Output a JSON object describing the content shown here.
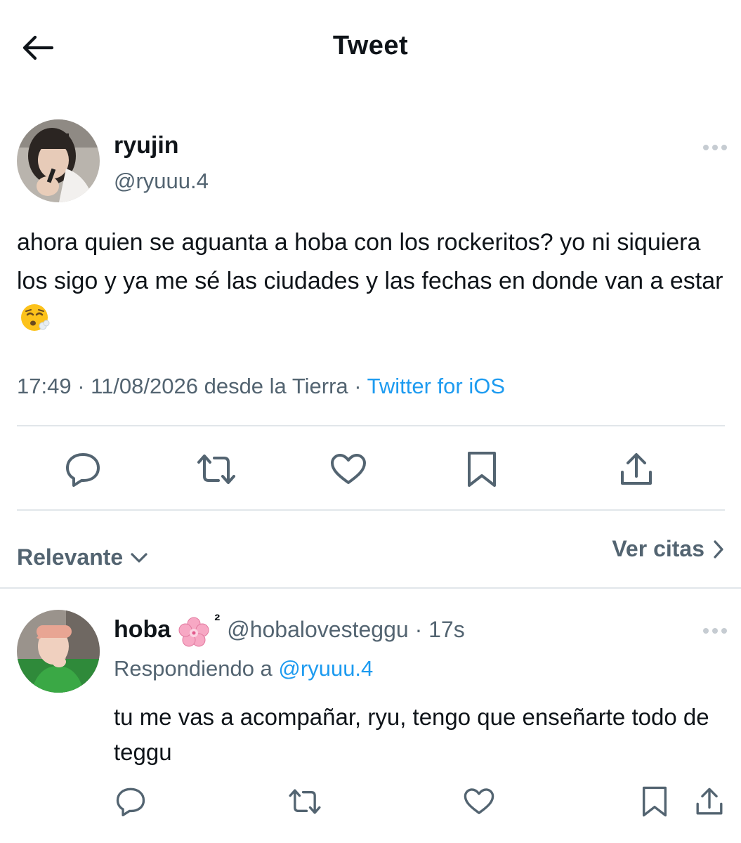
{
  "header": {
    "title": "Tweet",
    "back_icon": "arrow-left-icon"
  },
  "tweet": {
    "author_name": "ryujin",
    "author_handle": "@ryuuu.4",
    "text": "ahora quien se aguanta a hoba con los rockeritos? yo ni siquiera los sigo y ya me sé las ciudades y las fechas en donde van a estar",
    "emoji": "dizzy-face-emoji",
    "meta_time": "17:49 · 11/08/2026 desde la Tierra · ",
    "meta_source": "Twitter for iOS",
    "actions": [
      "reply-icon",
      "retweet-icon",
      "like-icon",
      "bookmark-icon",
      "share-icon"
    ]
  },
  "sort_bar": {
    "sort_label": "Relevante",
    "quotes_label": "Ver citas"
  },
  "reply": {
    "author_name": "hoba",
    "emoji": "cherry-blossom-emoji",
    "superscript": "²",
    "author_handle": "@hobalovesteggu · 17s",
    "replying_prefix": "Respondiendo a ",
    "replying_to": "@ryuuu.4",
    "text": "tu me vas a acompañar, ryu, tengo que enseñarte todo de teggu"
  },
  "colors": {
    "accent": "#1d9bf0",
    "secondary_text": "#536471",
    "icon": "#536471",
    "divider": "#e1e6ea"
  }
}
